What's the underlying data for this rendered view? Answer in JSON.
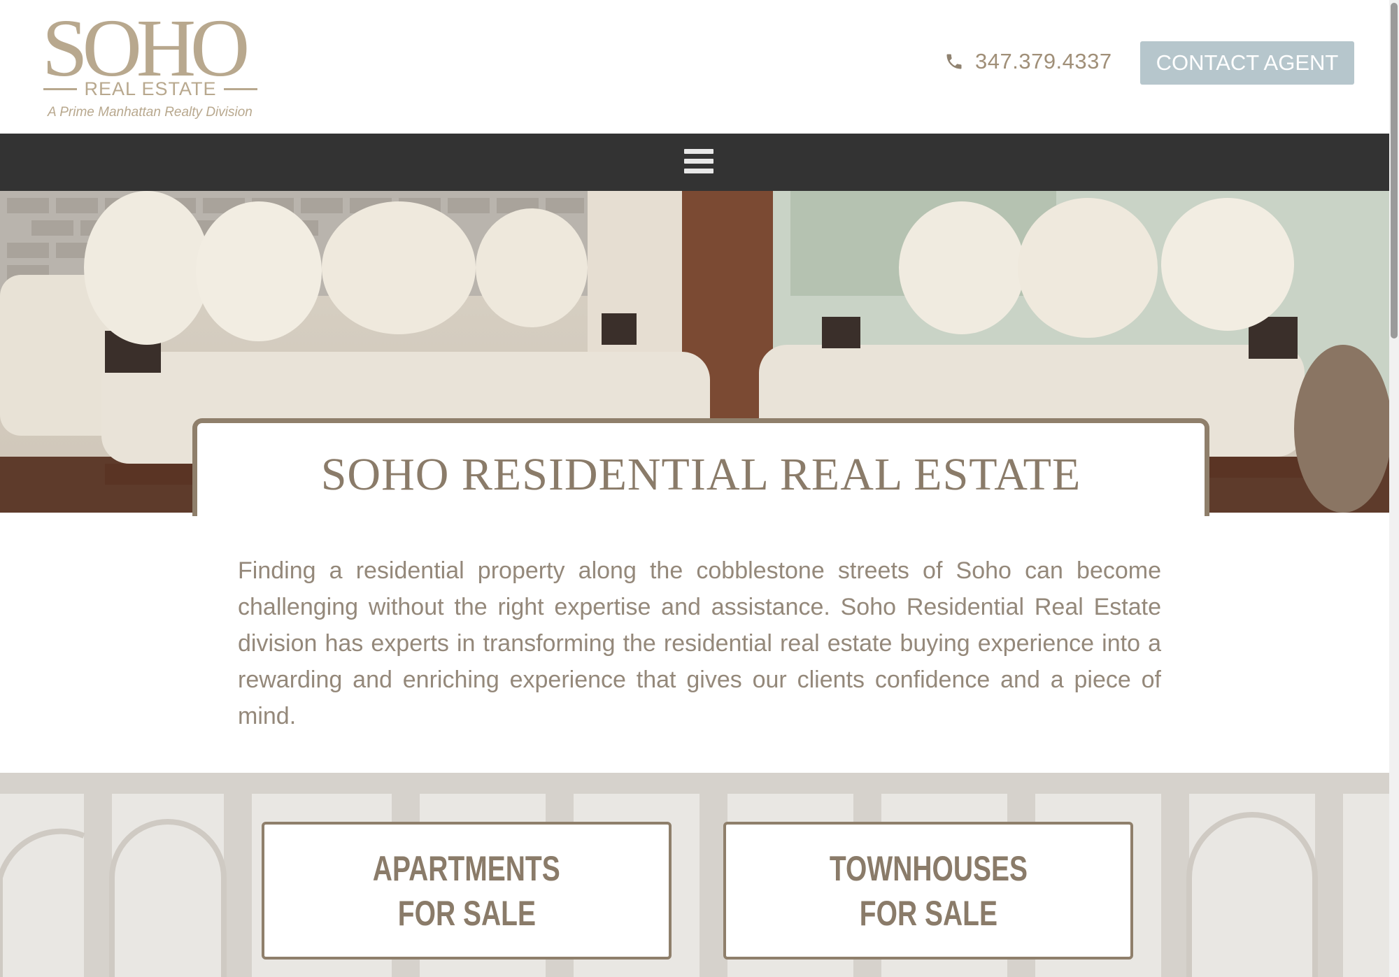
{
  "header": {
    "logo": {
      "main": "SOHO",
      "sub": "REAL ESTATE",
      "tagline": "A Prime Manhattan Realty Division"
    },
    "phone": "347.379.4337",
    "contact_label": "CONTACT AGENT"
  },
  "nav": {
    "menu_icon": "hamburger-menu-icon"
  },
  "hero": {
    "title": "SOHO RESIDENTIAL REAL ESTATE"
  },
  "intro": {
    "text": "Finding a residential property along the cobblestone streets of Soho can become challenging without the right expertise and assistance. Soho Residential Real Estate division has experts in transforming the residential real estate buying experience into a rewarding and enriching experience that gives our clients confidence and a piece of mind."
  },
  "categories": [
    {
      "line1": "APARTMENTS",
      "line2": "FOR SALE"
    },
    {
      "line1": "TOWNHOUSES",
      "line2": "FOR SALE"
    }
  ],
  "colors": {
    "brand": "#b8a88e",
    "text": "#8a7b69",
    "nav_bg": "#333333",
    "button_bg": "#b6c6cc"
  }
}
